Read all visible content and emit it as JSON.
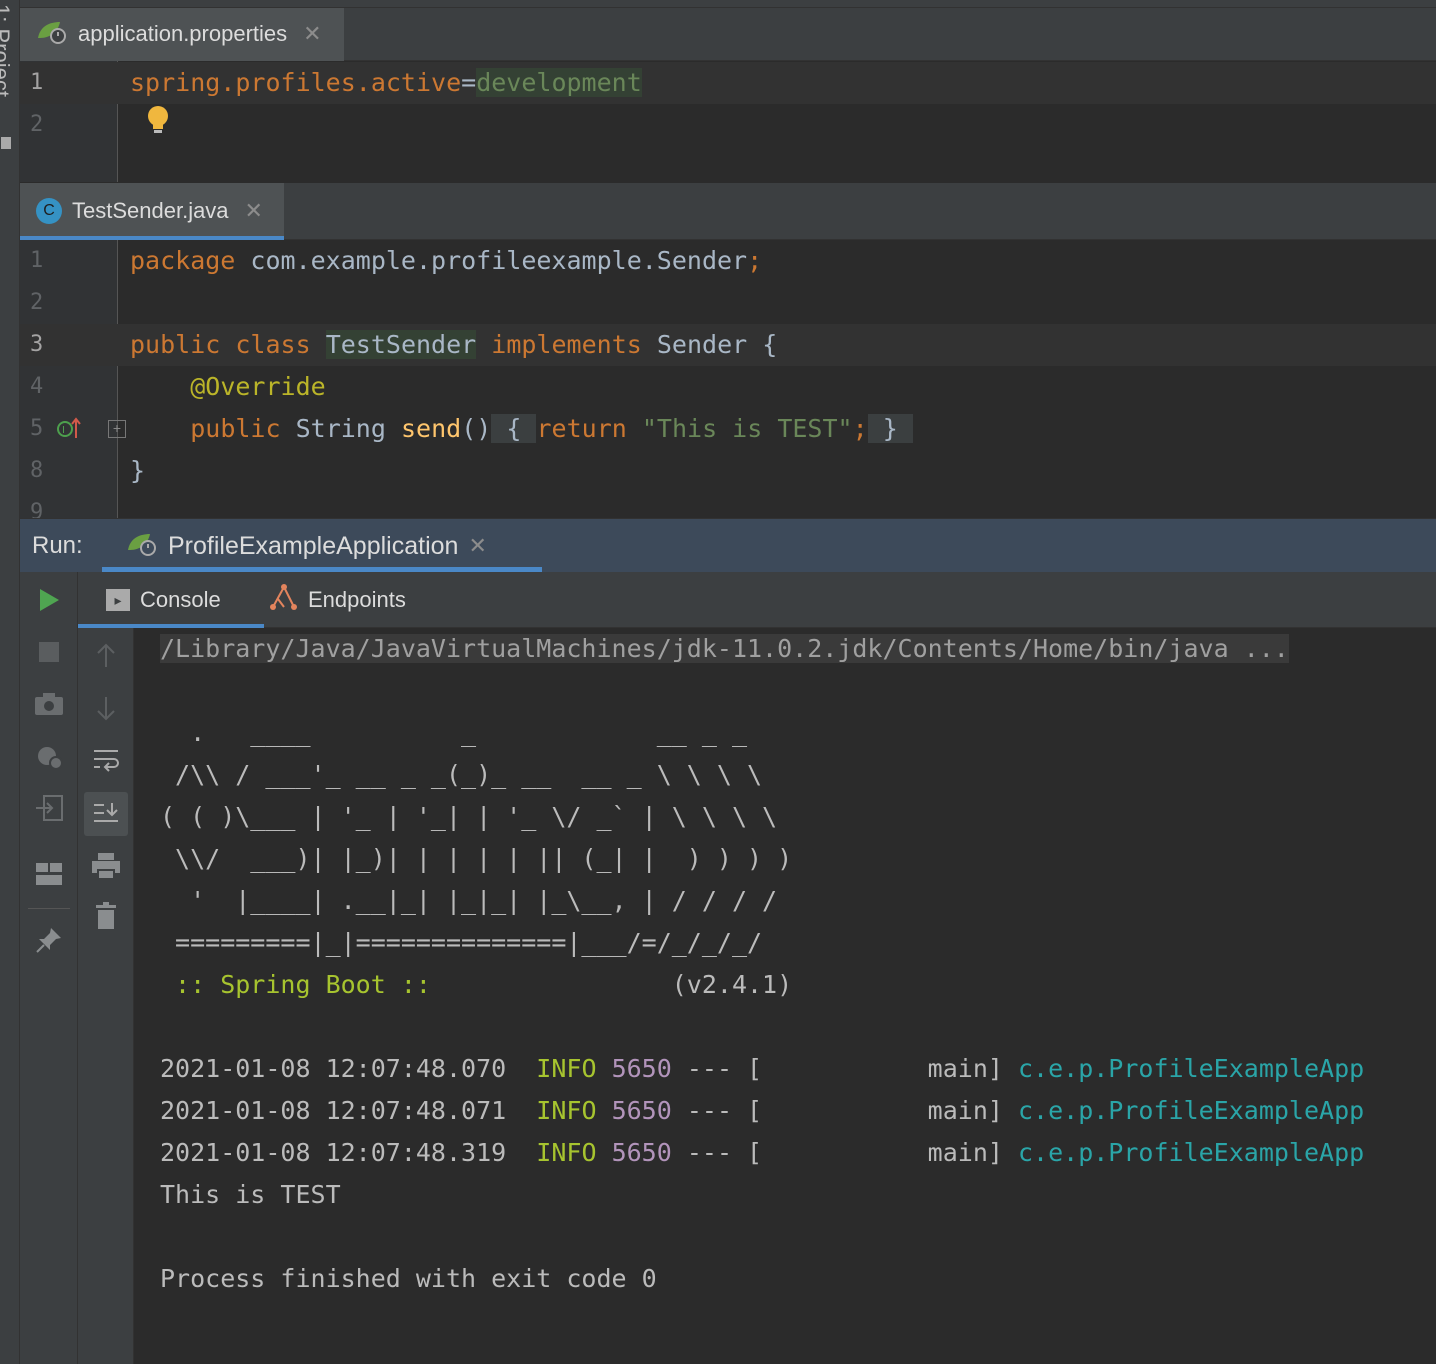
{
  "left_strip": {
    "label": "1: Project"
  },
  "props_tab": {
    "filename": "application.properties",
    "close": "✕"
  },
  "props_editor": {
    "lines": [
      {
        "n": "1",
        "key": "spring.profiles.active",
        "eq": "=",
        "value": "development"
      },
      {
        "n": "2"
      }
    ]
  },
  "java_tab": {
    "filename": "TestSender.java",
    "close": "✕",
    "icon_letter": "C"
  },
  "java_editor": {
    "lines": [
      {
        "n": "1",
        "kw": "package",
        "rest": " com.example.profileexample.Sender",
        "semi": ";"
      },
      {
        "n": "2"
      },
      {
        "n": "3",
        "kw1": "public",
        "kw2": "class",
        "cls": "TestSender",
        "kw3": "implements",
        "iface": "Sender",
        "brace": "{"
      },
      {
        "n": "4",
        "ann": "@Override"
      },
      {
        "n": "5",
        "kw1": "public",
        "type": "String",
        "fn": "send",
        "parens": "()",
        "ob": "{",
        "kw2": "return",
        "str": "\"This is TEST\"",
        "semi": ";",
        "cb": "}"
      },
      {
        "n": "8",
        "brace": "}"
      },
      {
        "n": "9"
      }
    ]
  },
  "run": {
    "label": "Run:",
    "tab": "ProfileExampleApplication",
    "close": "✕",
    "console_tab": "Console",
    "endpoints_tab": "Endpoints"
  },
  "console": {
    "command": "/Library/Java/JavaVirtualMachines/jdk-11.0.2.jdk/Contents/Home/bin/java ...",
    "banner": [
      "  .   ____          _            __ _ _",
      " /\\\\ / ___'_ __ _ _(_)_ __  __ _ \\ \\ \\ \\",
      "( ( )\\___ | '_ | '_| | '_ \\/ _` | \\ \\ \\ \\",
      " \\\\/  ___)| |_)| | | | | || (_| |  ) ) ) )",
      "  '  |____| .__|_| |_|_| |_\\__, | / / / /",
      " =========|_|==============|___/=/_/_/_/"
    ],
    "boot_label": " :: Spring Boot :: ",
    "boot_version": "               (v2.4.1)",
    "logs": [
      {
        "ts": "2021-01-08 12:07:48.070",
        "level": "INFO",
        "pid": "5650",
        "sep": " --- [",
        "thread": "           main]",
        "logger": "c.e.p.ProfileExampleApp"
      },
      {
        "ts": "2021-01-08 12:07:48.071",
        "level": "INFO",
        "pid": "5650",
        "sep": " --- [",
        "thread": "           main]",
        "logger": "c.e.p.ProfileExampleApp"
      },
      {
        "ts": "2021-01-08 12:07:48.319",
        "level": "INFO",
        "pid": "5650",
        "sep": " --- [",
        "thread": "           main]",
        "logger": "c.e.p.ProfileExampleApp"
      }
    ],
    "output": "This is TEST",
    "finish": "Process finished with exit code 0"
  }
}
